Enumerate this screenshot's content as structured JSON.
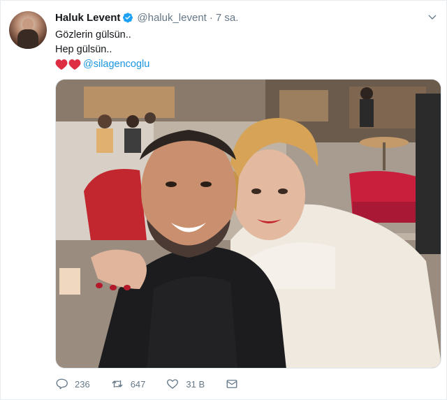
{
  "tweet": {
    "display_name": "Haluk Levent",
    "handle": "@haluk_levent",
    "separator": "·",
    "time": "7 sa.",
    "lines": [
      "Gözlerin gülsün..",
      "Hep gülsün.."
    ],
    "mention": "@silagencoglu",
    "heart_emoji_count": 2
  },
  "actions": {
    "replies": "236",
    "retweets": "647",
    "likes": "31 B"
  },
  "colors": {
    "link": "#1b95e0",
    "verified": "#1da1f2",
    "heart_emoji": "#dd2e44",
    "muted": "#657786"
  },
  "icons": [
    "verified-icon",
    "chevron-down-icon",
    "reply-icon",
    "retweet-icon",
    "like-icon",
    "direct-message-icon"
  ]
}
